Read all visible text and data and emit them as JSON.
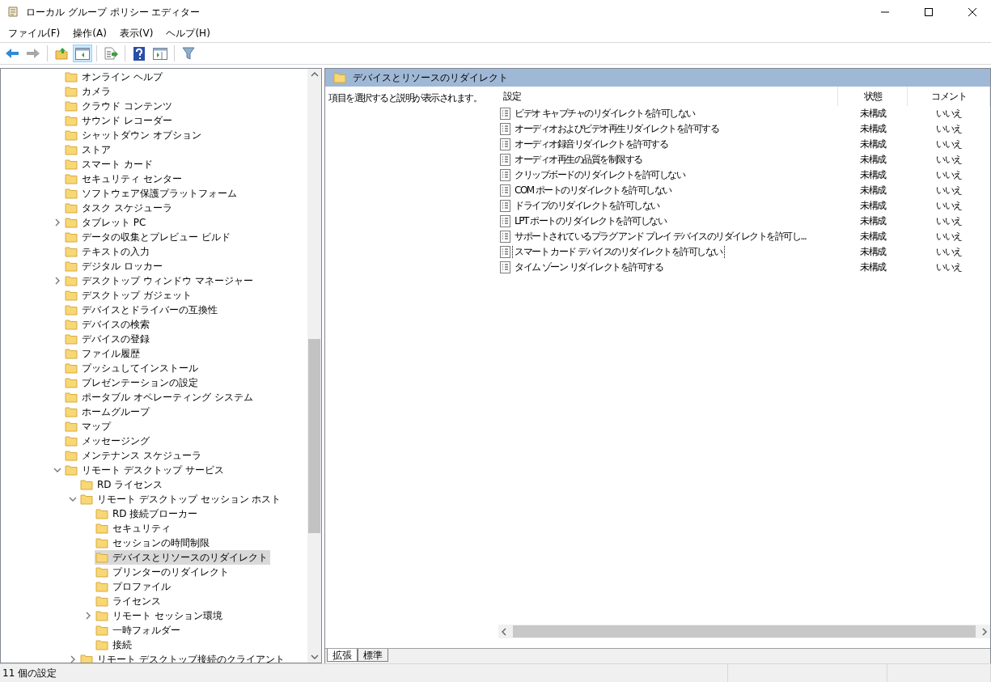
{
  "window": {
    "title": "ローカル グループ ポリシー エディター"
  },
  "menu": [
    "ファイル(F)",
    "操作(A)",
    "表示(V)",
    "ヘルプ(H)"
  ],
  "toolbar": [
    {
      "kind": "back",
      "pressed": false,
      "disabled": false
    },
    {
      "kind": "forward",
      "pressed": false,
      "disabled": true
    },
    {
      "kind": "up",
      "pressed": false,
      "disabled": false
    },
    {
      "kind": "tree",
      "pressed": true,
      "disabled": false
    },
    {
      "kind": "export",
      "pressed": false,
      "disabled": false
    },
    {
      "kind": "help",
      "pressed": false,
      "disabled": false
    },
    {
      "kind": "pane",
      "pressed": false,
      "disabled": false
    },
    {
      "kind": "filter",
      "pressed": false,
      "disabled": false
    }
  ],
  "tree": [
    {
      "label": "オンライン ヘルプ",
      "selected": false
    },
    {
      "label": "カメラ",
      "selected": false
    },
    {
      "label": "クラウド コンテンツ",
      "selected": false
    },
    {
      "label": "サウンド レコーダー",
      "selected": false
    },
    {
      "label": "シャットダウン オプション",
      "selected": false
    },
    {
      "label": "ストア",
      "selected": false
    },
    {
      "label": "スマート カード",
      "selected": false
    },
    {
      "label": "セキュリティ センター",
      "selected": false
    },
    {
      "label": "ソフトウェア保護プラットフォーム",
      "selected": false
    },
    {
      "label": "タスク スケジューラ",
      "selected": false
    },
    {
      "label": "タブレット PC",
      "selected": false,
      "expanded": false
    },
    {
      "label": "データの収集とプレビュー ビルド",
      "selected": false
    },
    {
      "label": "テキストの入力",
      "selected": false
    },
    {
      "label": "デジタル ロッカー",
      "selected": false
    },
    {
      "label": "デスクトップ ウィンドウ マネージャー",
      "selected": false,
      "expanded": false
    },
    {
      "label": "デスクトップ ガジェット",
      "selected": false
    },
    {
      "label": "デバイスとドライバーの互換性",
      "selected": false
    },
    {
      "label": "デバイスの検索",
      "selected": false
    },
    {
      "label": "デバイスの登録",
      "selected": false
    },
    {
      "label": "ファイル履歴",
      "selected": false
    },
    {
      "label": "プッシュしてインストール",
      "selected": false
    },
    {
      "label": "プレゼンテーションの設定",
      "selected": false
    },
    {
      "label": "ポータブル オペレーティング システム",
      "selected": false
    },
    {
      "label": "ホームグループ",
      "selected": false
    },
    {
      "label": "マップ",
      "selected": false
    },
    {
      "label": "メッセージング",
      "selected": false
    },
    {
      "label": "メンテナンス スケジューラ",
      "selected": false
    },
    {
      "label": "リモート デスクトップ サービス",
      "selected": false,
      "expanded": true,
      "children": [
        {
          "label": "RD ライセンス",
          "selected": false
        },
        {
          "label": "リモート デスクトップ セッション ホスト",
          "selected": false,
          "expanded": true,
          "children": [
            {
              "label": "RD 接続ブローカー",
              "selected": false
            },
            {
              "label": "セキュリティ",
              "selected": false
            },
            {
              "label": "セッションの時間制限",
              "selected": false
            },
            {
              "label": "デバイスとリソースのリダイレクト",
              "selected": true
            },
            {
              "label": "プリンターのリダイレクト",
              "selected": false
            },
            {
              "label": "プロファイル",
              "selected": false
            },
            {
              "label": "ライセンス",
              "selected": false
            },
            {
              "label": "リモート セッション環境",
              "selected": false,
              "expanded": false
            },
            {
              "label": "一時フォルダー",
              "selected": false
            },
            {
              "label": "接続",
              "selected": false
            }
          ]
        },
        {
          "label": "リモート デスクトップ接続のクライアント",
          "selected": false,
          "expanded": false
        }
      ]
    }
  ],
  "pane": {
    "title": "デバイスとリソースのリダイレクト",
    "description": "項目を選択すると説明が表示されます。",
    "columns": [
      "設定",
      "状態",
      "コメント"
    ],
    "rows": [
      {
        "setting": "ビデオ キャプチャのリダイレクトを許可しない",
        "state": "未構成",
        "comment": "いいえ",
        "focused": false
      },
      {
        "setting": "オーディオおよびビデオ再生リダイレクトを許可する",
        "state": "未構成",
        "comment": "いいえ",
        "focused": false
      },
      {
        "setting": "オーディオ録音リダイレクトを許可する",
        "state": "未構成",
        "comment": "いいえ",
        "focused": false
      },
      {
        "setting": "オーディオ再生の品質を制限する",
        "state": "未構成",
        "comment": "いいえ",
        "focused": false
      },
      {
        "setting": "クリップボードのリダイレクトを許可しない",
        "state": "未構成",
        "comment": "いいえ",
        "focused": false
      },
      {
        "setting": "COM ポートのリダイレクトを許可しない",
        "state": "未構成",
        "comment": "いいえ",
        "focused": false
      },
      {
        "setting": "ドライブのリダイレクトを許可しない",
        "state": "未構成",
        "comment": "いいえ",
        "focused": false
      },
      {
        "setting": "LPT ポートのリダイレクトを許可しない",
        "state": "未構成",
        "comment": "いいえ",
        "focused": false
      },
      {
        "setting": "サポートされているプラグ アンド プレイ デバイスのリダイレクトを許可し...",
        "state": "未構成",
        "comment": "いいえ",
        "focused": false
      },
      {
        "setting": "スマート カード デバイスのリダイレクトを許可しない",
        "state": "未構成",
        "comment": "いいえ",
        "focused": true
      },
      {
        "setting": "タイム ゾーン リダイレクトを許可する",
        "state": "未構成",
        "comment": "いいえ",
        "focused": false
      }
    ],
    "tabs": [
      {
        "label": "拡張",
        "selected": true
      },
      {
        "label": "標準",
        "selected": false
      }
    ]
  },
  "status_bar": {
    "text": "11 個の設定"
  }
}
